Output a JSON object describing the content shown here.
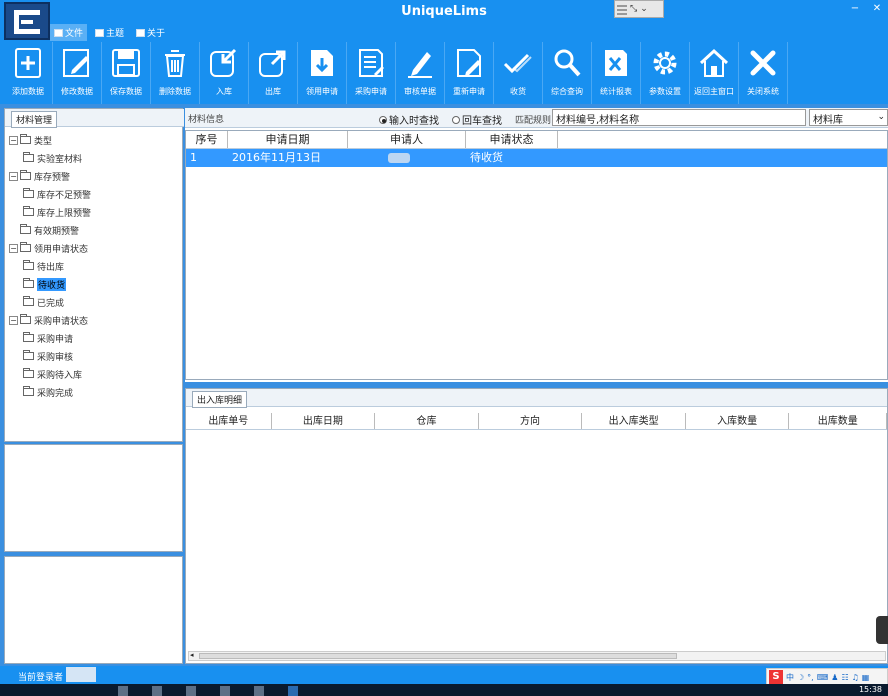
{
  "app": {
    "title": "UniqueLims"
  },
  "menus": [
    {
      "label": "文件",
      "active": true
    },
    {
      "label": "主题",
      "active": false
    },
    {
      "label": "关于",
      "active": false
    }
  ],
  "window_controls": [
    "⤡",
    "✕"
  ],
  "toolbar": [
    {
      "label": "添加数据",
      "icon": "add-icon"
    },
    {
      "label": "修改数据",
      "icon": "edit-icon"
    },
    {
      "label": "保存数据",
      "icon": "save-icon"
    },
    {
      "label": "删除数据",
      "icon": "trash-icon"
    },
    {
      "label": "入库",
      "icon": "import-icon"
    },
    {
      "label": "出库",
      "icon": "export-icon"
    },
    {
      "label": "领用申请",
      "icon": "download-doc-icon"
    },
    {
      "label": "采购申请",
      "icon": "doc-list-icon"
    },
    {
      "label": "审核单据",
      "icon": "pen-icon"
    },
    {
      "label": "重新申请",
      "icon": "doc-edit-icon"
    },
    {
      "label": "收货",
      "icon": "check-icon"
    },
    {
      "label": "综合查询",
      "icon": "search-icon"
    },
    {
      "label": "统计报表",
      "icon": "excel-icon"
    },
    {
      "label": "参数设置",
      "icon": "gear-icon"
    },
    {
      "label": "返回主窗口",
      "icon": "home-icon"
    },
    {
      "label": "关闭系统",
      "icon": "close-icon"
    }
  ],
  "left_panel": {
    "tab": "材料管理",
    "tree": [
      {
        "label": "类型",
        "level": 0,
        "expander": "−"
      },
      {
        "label": "实验室材料",
        "level": 1
      },
      {
        "label": "库存预警",
        "level": 0,
        "expander": "−"
      },
      {
        "label": "库存不足预警",
        "level": 1
      },
      {
        "label": "库存上限预警",
        "level": 1
      },
      {
        "label": "有效期预警",
        "level": 0
      },
      {
        "label": "领用申请状态",
        "level": 0,
        "expander": "−"
      },
      {
        "label": "待出库",
        "level": 1
      },
      {
        "label": "待收货",
        "level": 1,
        "selected": true
      },
      {
        "label": "已完成",
        "level": 1
      },
      {
        "label": "采购申请状态",
        "level": 0,
        "expander": "−"
      },
      {
        "label": "采购申请",
        "level": 1
      },
      {
        "label": "采购审核",
        "level": 1
      },
      {
        "label": "采购待入库",
        "level": 1
      },
      {
        "label": "采购完成",
        "level": 1
      }
    ]
  },
  "material_info": {
    "section_label": "材料信息",
    "radio1": "输入时查找",
    "radio2": "回车查找",
    "match_label": "匹配规则",
    "search_value": "材料编号,材料名称",
    "store_select": "材料库",
    "columns": [
      "序号",
      "申请日期",
      "申请人",
      "申请状态"
    ],
    "rows": [
      {
        "index": "1",
        "date": "2016年11月13日",
        "applicant": "",
        "status": "待收货"
      }
    ]
  },
  "inout_detail": {
    "tab": "出入库明细",
    "columns": [
      "出库单号",
      "出库日期",
      "仓库",
      "方向",
      "出入库类型",
      "入库数量",
      "出库数量"
    ]
  },
  "status": {
    "login_label": "当前登录者"
  },
  "ime": {
    "brand": "S",
    "items": [
      "中",
      "☽",
      "°,",
      "⌨",
      "♟",
      "☷",
      "♫",
      "▦"
    ]
  },
  "taskbar": {
    "clock": "15:38"
  },
  "colors": {
    "brand_blue": "#1890f0",
    "selection": "#3399ff"
  }
}
